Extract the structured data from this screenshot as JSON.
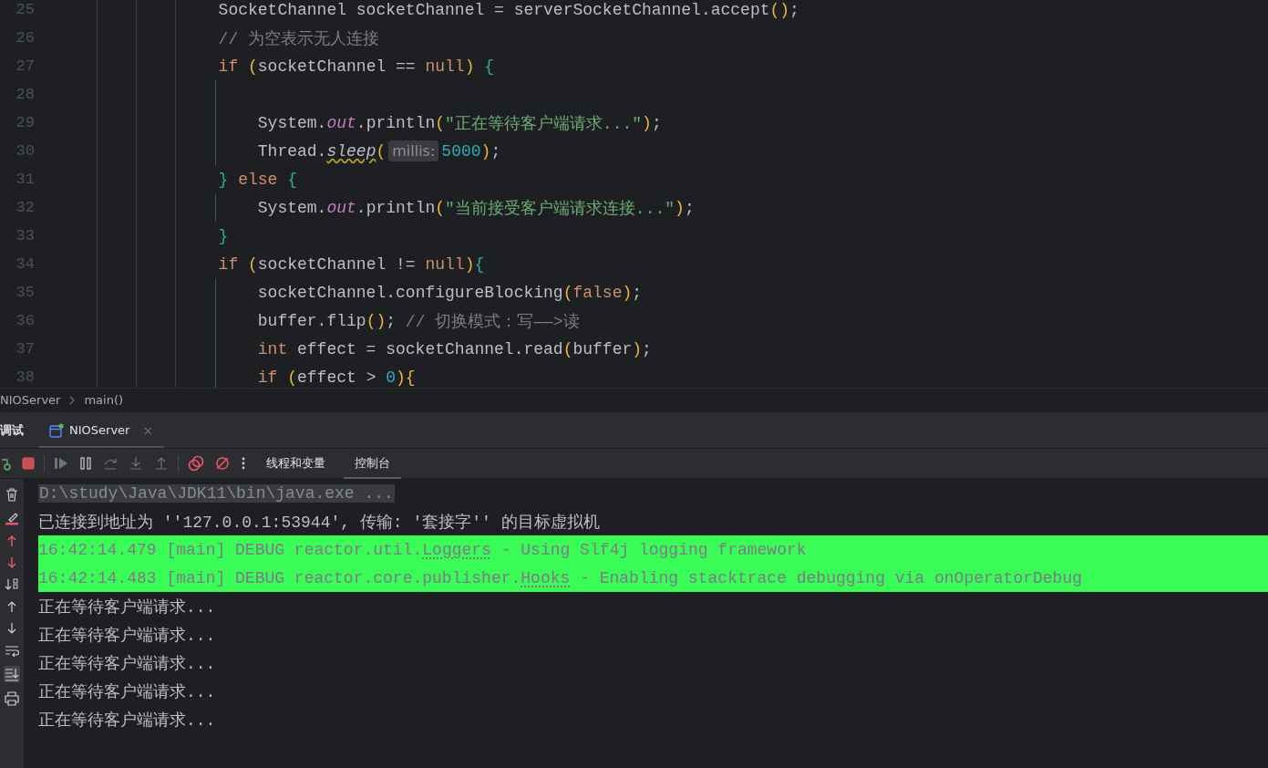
{
  "editor": {
    "lines": [
      {
        "number": "25",
        "tokens": [
          {
            "kind": "plain",
            "text": "SocketChannel socketChannel = serverSocketChannel.accept"
          },
          {
            "kind": "bracket",
            "color": "#e8ba36",
            "text": "()"
          },
          {
            "kind": "plain",
            "text": ";"
          }
        ]
      },
      {
        "number": "26",
        "tokens": [
          {
            "kind": "comment",
            "text": "// 为空表示无人连接"
          }
        ]
      },
      {
        "number": "27",
        "tokens": [
          {
            "kind": "keyword",
            "text": "if",
            "spaced": true
          },
          {
            "kind": "bracket",
            "color": "#e8ba36",
            "text": "("
          },
          {
            "kind": "plain",
            "text": "socketChannel == "
          },
          {
            "kind": "keyword",
            "text": "null"
          },
          {
            "kind": "bracket",
            "color": "#e8ba36",
            "text": ")",
            "spaced": true
          },
          {
            "kind": "bracket",
            "color": "#2aaf9a",
            "text": "{"
          }
        ],
        "children": [
          {
            "number": "28"
          },
          {
            "number": "29",
            "tokens": [
              {
                "kind": "plain",
                "text": "System."
              },
              {
                "kind": "field",
                "text": "out"
              },
              {
                "kind": "plain",
                "text": ".println"
              },
              {
                "kind": "bracket",
                "color": "#e8ba36",
                "text": "("
              },
              {
                "kind": "string",
                "text": "\"正在等待客户端请求...\""
              },
              {
                "kind": "bracket",
                "color": "#e8ba36",
                "text": ")"
              },
              {
                "kind": "plain",
                "text": ";"
              }
            ]
          },
          {
            "number": "30",
            "tokens": [
              {
                "kind": "plain",
                "text": "Thread."
              },
              {
                "kind": "static",
                "text": "sleep"
              },
              {
                "kind": "bracket",
                "color": "#e8ba36",
                "text": "("
              },
              {
                "kind": "hint",
                "text": "millis:"
              },
              {
                "kind": "number",
                "text": "5000"
              },
              {
                "kind": "bracket",
                "color": "#e8ba36",
                "text": ")"
              },
              {
                "kind": "plain",
                "text": ";"
              }
            ]
          }
        ]
      },
      {
        "number": "31",
        "tokens": [
          {
            "kind": "bracket",
            "color": "#2aaf9a",
            "text": "}",
            "spaced": true
          },
          {
            "kind": "keyword",
            "text": "else",
            "spaced": true
          },
          {
            "kind": "bracket",
            "color": "#2aaf9a",
            "text": "{"
          }
        ],
        "children": [
          {
            "number": "32",
            "tokens": [
              {
                "kind": "plain",
                "text": "System."
              },
              {
                "kind": "field",
                "text": "out"
              },
              {
                "kind": "plain",
                "text": ".println"
              },
              {
                "kind": "bracket",
                "color": "#e8ba36",
                "text": "("
              },
              {
                "kind": "string",
                "text": "\"当前接受客户端请求连接...\""
              },
              {
                "kind": "bracket",
                "color": "#e8ba36",
                "text": ")"
              },
              {
                "kind": "plain",
                "text": ";"
              }
            ]
          }
        ]
      },
      {
        "number": "33",
        "tokens": [
          {
            "kind": "bracket",
            "color": "#2aaf9a",
            "text": "}"
          }
        ]
      },
      {
        "number": "34",
        "tokens": [
          {
            "kind": "keyword",
            "text": "if",
            "spaced": true
          },
          {
            "kind": "bracket",
            "color": "#e8ba36",
            "text": "("
          },
          {
            "kind": "plain",
            "text": "socketChannel != "
          },
          {
            "kind": "keyword",
            "text": "null"
          },
          {
            "kind": "bracket",
            "color": "#e8ba36",
            "text": ")"
          },
          {
            "kind": "bracket",
            "color": "#2aaf9a",
            "text": "{"
          }
        ],
        "children": [
          {
            "number": "35",
            "tokens": [
              {
                "kind": "plain",
                "text": "socketChannel.configureBlocking"
              },
              {
                "kind": "bracket",
                "color": "#e8ba36",
                "text": "("
              },
              {
                "kind": "keyword",
                "text": "false"
              },
              {
                "kind": "bracket",
                "color": "#e8ba36",
                "text": ")"
              },
              {
                "kind": "plain",
                "text": ";"
              }
            ]
          },
          {
            "number": "36",
            "tokens": [
              {
                "kind": "plain",
                "text": "buffer.flip"
              },
              {
                "kind": "bracket",
                "color": "#e8ba36",
                "text": "()"
              },
              {
                "kind": "plain",
                "text": ";",
                "spaced": true
              },
              {
                "kind": "comment",
                "text": "// 切换模式：写——>读"
              }
            ]
          },
          {
            "number": "37",
            "tokens": [
              {
                "kind": "keyword",
                "text": "int",
                "spaced": true
              },
              {
                "kind": "plain",
                "text": "effect = socketChannel.read"
              },
              {
                "kind": "bracket",
                "color": "#e8ba36",
                "text": "("
              },
              {
                "kind": "plain",
                "text": "buffer"
              },
              {
                "kind": "bracket",
                "color": "#e8ba36",
                "text": ")"
              },
              {
                "kind": "plain",
                "text": ";"
              }
            ]
          },
          {
            "number": "38",
            "tokens": [
              {
                "kind": "keyword",
                "text": "if",
                "spaced": true
              },
              {
                "kind": "bracket",
                "color": "#e8ba36",
                "text": "("
              },
              {
                "kind": "plain",
                "text": "effect > "
              },
              {
                "kind": "number",
                "text": "0"
              },
              {
                "kind": "bracket",
                "color": "#e8ba36",
                "text": ")"
              },
              {
                "kind": "bracket",
                "color": "#e8ba36",
                "text": "{"
              }
            ]
          }
        ]
      }
    ]
  },
  "breadcrumb": [
    "NIOServer",
    "main()"
  ],
  "debug_panel": {
    "title": "调试",
    "tabs": [
      {
        "label": "NIOServer",
        "selected": true,
        "close": "×"
      }
    ],
    "subtabs": [
      {
        "label": "线程和变量",
        "selected": false
      },
      {
        "label": "控制台",
        "selected": true
      }
    ],
    "console": {
      "lines": [
        {
          "kind": "command",
          "text": "D:\\study\\Java\\JDK11\\bin\\java.exe ..."
        },
        {
          "kind": "info",
          "text": "已连接到地址为 ''127.0.0.1:53944', 传输: '套接字'' 的目标虚拟机"
        },
        {
          "kind": "debug",
          "prefix": "16:42:14.479 [main] DEBUG reactor.util.",
          "link": "Loggers",
          "suffix": " - Using Slf4j logging framework"
        },
        {
          "kind": "debug",
          "prefix": "16:42:14.483 [main] DEBUG reactor.core.publisher.",
          "link": "Hooks",
          "suffix": " - Enabling stacktrace debugging via onOperatorDebug"
        },
        {
          "kind": "output",
          "text": "正在等待客户端请求..."
        },
        {
          "kind": "output",
          "text": "正在等待客户端请求..."
        },
        {
          "kind": "output",
          "text": "正在等待客户端请求..."
        },
        {
          "kind": "output",
          "text": "正在等待客户端请求..."
        },
        {
          "kind": "output",
          "text": "正在等待客户端请求..."
        }
      ]
    }
  }
}
